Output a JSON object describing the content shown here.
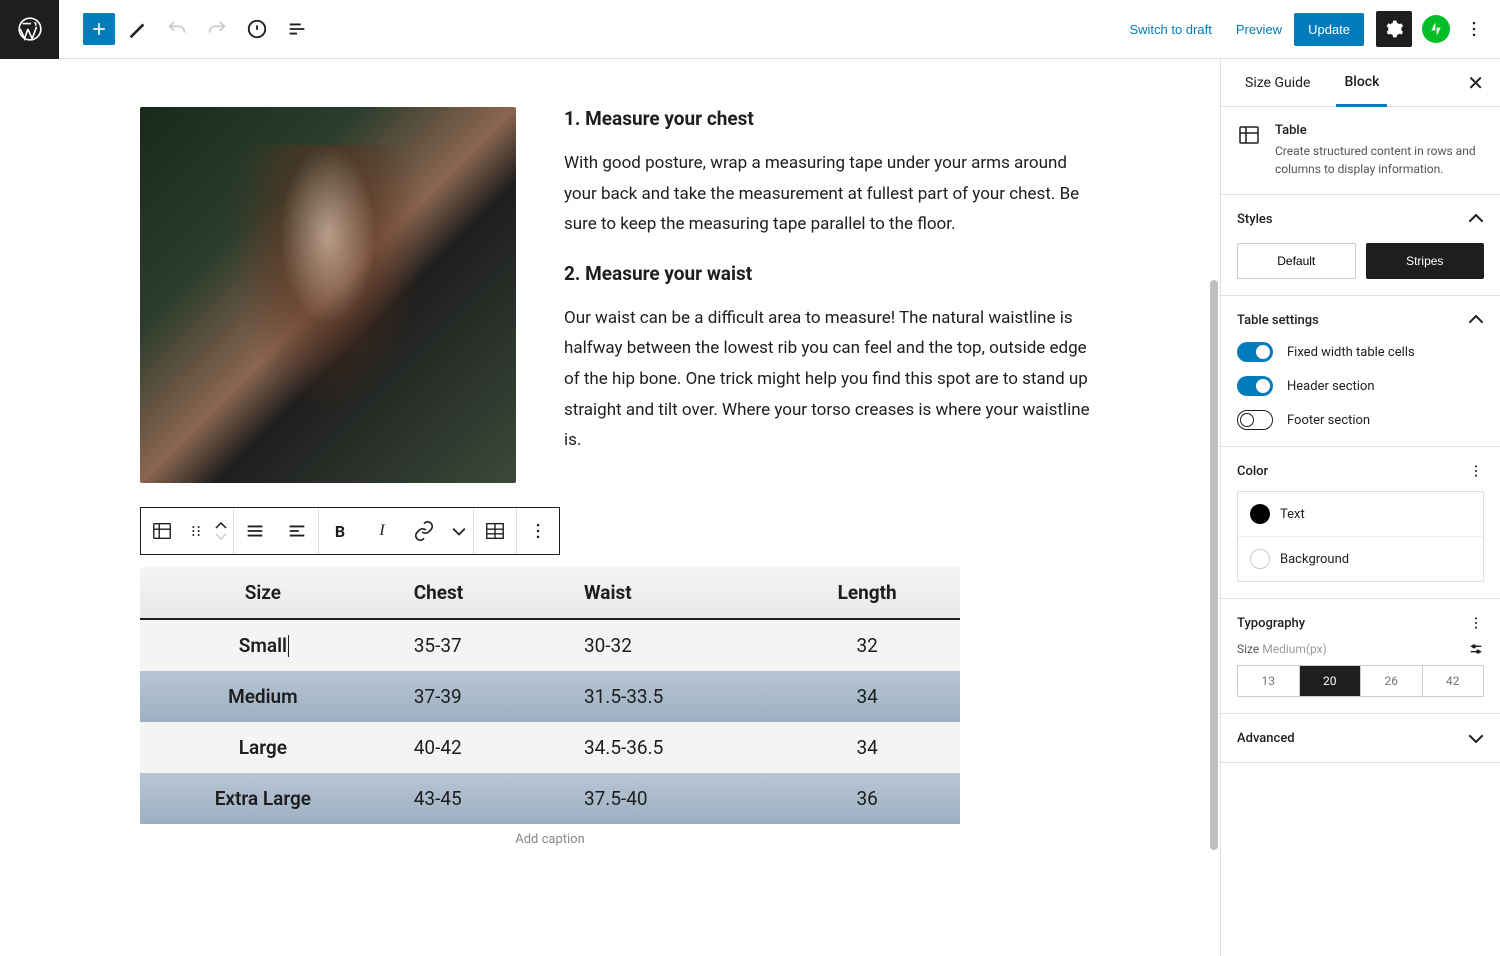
{
  "topbar": {
    "switch_to_draft": "Switch to draft",
    "preview": "Preview",
    "update": "Update"
  },
  "content": {
    "h1": "1. Measure your chest",
    "p1": "With good posture, wrap a measuring tape under your arms around your back and take the measurement at fullest part of your chest. Be sure to keep the measuring tape parallel to the floor.",
    "h2": "2. Measure your waist",
    "p2": "Our waist can be a difficult area to measure! The natural waistline is halfway between the lowest rib you can feel and the top, outside edge of the hip bone. One trick might help you find this spot are to stand up straight and tilt over. Where your torso creases is where your waistline is.",
    "caption_placeholder": "Add caption"
  },
  "chart_data": {
    "type": "table",
    "headers": [
      "Size",
      "Chest",
      "Waist",
      "Length"
    ],
    "rows": [
      [
        "Small",
        "35-37",
        "30-32",
        "32"
      ],
      [
        "Medium",
        "37-39",
        "31.5-33.5",
        "34"
      ],
      [
        "Large",
        "40-42",
        "34.5-36.5",
        "34"
      ],
      [
        "Extra Large",
        "43-45",
        "37.5-40",
        "36"
      ]
    ]
  },
  "sidebar": {
    "tabs": {
      "document": "Size Guide",
      "block": "Block"
    },
    "block_name": "Table",
    "block_desc": "Create structured content in rows and columns to display information.",
    "styles": {
      "title": "Styles",
      "default": "Default",
      "stripes": "Stripes"
    },
    "table_settings": {
      "title": "Table settings",
      "fixed": "Fixed width table cells",
      "header": "Header section",
      "footer": "Footer section"
    },
    "color": {
      "title": "Color",
      "text": "Text",
      "background": "Background",
      "colors": {
        "text": "#000000",
        "background": "#ffffff"
      }
    },
    "typography": {
      "title": "Typography",
      "size_label": "Size",
      "size_suffix": "Medium(px)",
      "segments": [
        "13",
        "20",
        "26",
        "42"
      ]
    },
    "advanced": "Advanced"
  }
}
